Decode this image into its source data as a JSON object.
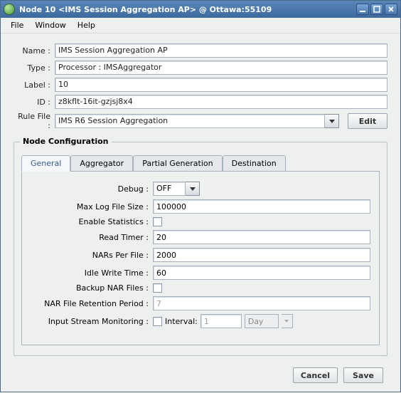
{
  "window": {
    "title": "Node 10 <IMS Session Aggregation AP> @ Ottawa:55109"
  },
  "menu": {
    "file": "File",
    "window": "Window",
    "help": "Help"
  },
  "form": {
    "name_label": "Name :",
    "name_value": "IMS Session Aggregation AP",
    "type_label": "Type :",
    "type_value": "Processor : IMSAggregator",
    "label_label": "Label :",
    "label_value": "10",
    "id_label": "ID :",
    "id_value": "z8kflt-16it-gzjsj8x4",
    "rulefile_label": "Rule File :",
    "rulefile_value": "IMS R6 Session Aggregation",
    "edit_btn": "Edit"
  },
  "section": {
    "title": "Node Configuration",
    "tabs": {
      "general": "General",
      "aggregator": "Aggregator",
      "partial": "Partial Generation",
      "destination": "Destination"
    }
  },
  "cfg": {
    "debug_label": "Debug :",
    "debug_value": "OFF",
    "maxlog_label": "Max Log File Size :",
    "maxlog_value": "100000",
    "stats_label": "Enable Statistics :",
    "readtimer_label": "Read Timer :",
    "readtimer_value": "20",
    "nars_label": "NARs Per File :",
    "nars_value": "2000",
    "idle_label": "Idle Write Time :",
    "idle_value": "60",
    "backup_label": "Backup NAR Files :",
    "retention_label": "NAR File Retention Period :",
    "retention_value": "7",
    "monitor_label": "Input Stream Monitoring :",
    "monitor_interval_label": "Interval:",
    "monitor_interval_value": "1",
    "monitor_unit": "Day"
  },
  "dialog": {
    "cancel": "Cancel",
    "save": "Save"
  }
}
